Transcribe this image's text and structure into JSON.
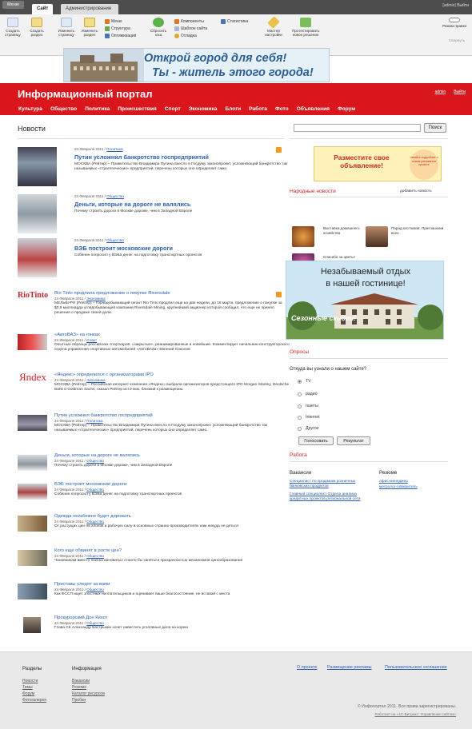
{
  "admin": {
    "tabs": {
      "menu": "Меню",
      "site": "Сайт",
      "admin": "Администрирование"
    },
    "right": "[admin]   Выйти",
    "buttons": [
      {
        "label": "Создать страницу",
        "icon": "create-page-icon"
      },
      {
        "label": "Создать раздел",
        "icon": "create-section-icon"
      },
      {
        "label": "Изменить страницу",
        "icon": "edit-page-icon"
      },
      {
        "label": "Изменить раздел",
        "icon": "edit-section-icon"
      }
    ],
    "menu_items": [
      "Меню",
      "Структура",
      "Оптимизация"
    ],
    "reset_cache": "Сбросить кэш",
    "components_items": [
      "Компоненты",
      "Шаблон сайта",
      "Отладка"
    ],
    "stats": "Статистика",
    "wizard": "Мастер настройки",
    "test": "Протестировать новое решение",
    "edit_mode": "Режим правки",
    "collapse": "Свернуть"
  },
  "banner": {
    "line1": "Открой город для себя!",
    "line2": "Ты - житель этого города!"
  },
  "header": {
    "title": "Информационный портал",
    "links": [
      "admin",
      "Выйти"
    ]
  },
  "nav": [
    "Культура",
    "Общество",
    "Политика",
    "Происшествия",
    "Спорт",
    "Экономика",
    "Блоги",
    "Работа",
    "Фото",
    "Объявления",
    "Форум"
  ],
  "news": {
    "heading": "Новости",
    "featured": [
      {
        "date": "24 Февраля 2011",
        "rubric": "Политика",
        "title": "Путин усложнил банкротство госпредприятий",
        "text": "МОСКВА (Рейтер) – Правительство Владимира Путина внесло в Госдуму законопроект, усложняющий банкротство так называемых «стратегических» предприятий, перечень которых оно определяет само."
      },
      {
        "date": "24 Февраля 2011",
        "rubric": "Общество",
        "title": "Деньги, которые на дороге не валялись",
        "text": "Почему строить дороги в Москве дороже, чем в Западной Европе"
      },
      {
        "date": "24 Февраля 2011",
        "rubric": "Общество",
        "title": "ВЭБ построит московские дороги",
        "text": "Собянин попросил у ВЭБа денег на подготовку транспортных проектов"
      }
    ],
    "list": [
      {
        "logo": "RioTinto",
        "title": "Rio Tinto продлила предложение о покупке Riversdale",
        "date": "24 Февраля 2011",
        "rubric": "Экономика",
        "text": "МЕЛЬБУРН (Рейтер) – Горнодобывающий гигант Rio Tinto продлил еще на две недели, до 18 марта, предложение о покупке за $3,9 миллиарда угледобывающей компании Riversdale Mining, крупнейший акционер которой сообщил, что еще не принял решения о продаже своей доли."
      },
      {
        "logo": "",
        "title": "«АвтоВАЗ» на гонках",
        "date": "24 Февраля 2011",
        "rubric": "Спорт",
        "text": "Опытные образцы российских спорткаров: «закрытые», реанимированные и новейшие. Комментирует начальник конструкторского отдела управления спортивных автомобилей «АвтоВАЗа» Евгений Соколов"
      },
      {
        "logo": "Яndex",
        "title": "«Яндекс» определился с организаторами IPO",
        "date": "24 Февраля 2011",
        "rubric": "Экономика",
        "text": "МОСКВА (Рейтер) – Российская интернет-компания «Яндекс» выбрала организаторов предстоящего IPO Morgan Stanley, Deutsche Bank и Goldman Sachs, сказал Рейтер источник, близкий к размещению."
      },
      {
        "logo": "",
        "title": "Путин усложнил банкротство госпредприятий",
        "date": "24 Февраля 2011",
        "rubric": "Политика",
        "text": "МОСКВА (Рейтер) – Правительство Владимира Путина внесло в Госдуму законопроект, усложняющий банкротство так называемых «стратегических» предприятий, перечень которых оно определяет само."
      },
      {
        "logo": "",
        "title": "Деньги, которые на дороге не валялись",
        "date": "24 Февраля 2011",
        "rubric": "Общество",
        "text": "Почему строить дороги в Москве дороже, чем в Западной Европе"
      },
      {
        "logo": "",
        "title": "ВЭБ построит московские дороги",
        "date": "24 Февраля 2011",
        "rubric": "Общество",
        "text": "Собянин попросил у ВЭБа денег на подготовку транспортных проектов"
      },
      {
        "logo": "",
        "title": "Одежда неизбежно будет дорожать",
        "date": "24 Февраля 2011",
        "rubric": "Общество",
        "text": "От растущих цен на хлопок и рабочую силу в основных странах-производителях нам никуда не деться"
      },
      {
        "logo": "",
        "title": "Кого еще обвинят в росте цен?",
        "date": "24 Февраля 2011",
        "rubric": "Общество",
        "text": "Чиновникам вместо поиска виноватых стоило бы заняться прозрачностью механизмов ценообразования"
      },
      {
        "logo": "",
        "title": "Приставы следят за вами",
        "date": "24 Февраля 2011",
        "rubric": "Общество",
        "text": "Как ФССП ищет злостных неплательщиков и оценивает ваше благосостояние, не вставая с места"
      },
      {
        "logo": "",
        "title": "Прокурорский Дон Кихот",
        "date": "24 Февраля 2011",
        "rubric": "Общество",
        "text": "Глава СК Александр Бастрыкин хочет навестить уголовные дела на корню"
      }
    ]
  },
  "search": {
    "placeholder": "",
    "button": "Поиск"
  },
  "ad_top": {
    "text": "Разместите свое объявление!",
    "badge": "Узнайте подробнее о новом рекламном проекте"
  },
  "people_news": {
    "heading": "Народные новости",
    "add": "добавить новость",
    "items": [
      "Выставка домашнего хозяйства",
      "Парад костюмов. Приглашаем всех.",
      "Спасибо за цветы!"
    ]
  },
  "ad_hotel": {
    "line1": "Незабываемый отдых",
    "line2": "в нашей гостинице!",
    "stamp": "Сезонные скидки!"
  },
  "poll": {
    "heading": "Опросы",
    "question": "Откуда вы узнали о нашем сайте?",
    "options": [
      "TV",
      "радио",
      "газеты",
      "Internet",
      "Другое"
    ],
    "selected": 0,
    "vote": "Голосовать",
    "result": "Результат"
  },
  "jobs": {
    "heading": "Работа",
    "vacancies_head": "Вакансии",
    "resume_head": "Резюме",
    "vacancies": [
      "Специалист по продажам розничных банковских продуктов",
      "Главный специалист Отдела анализа кредитных проектов региональной сети"
    ],
    "resumes": [
      "офис-менеджер",
      "метролог-поверитель"
    ]
  },
  "footer": {
    "col1_head": "Разделы",
    "col1": [
      "Новости",
      "Темы",
      "Форум",
      "Фотогалерея"
    ],
    "col2_head": "Информация",
    "col2": [
      "Вакансии",
      "Резюме",
      "Каталог ресурсов",
      "Пробки"
    ],
    "top_links": [
      "О проекте",
      "Размещение рекламы",
      "Пользовательское соглашение"
    ],
    "copyright": "© Инфопортал 2011. Все права зарегистрированы.",
    "made_by": "Работает на «1С-Битрикс: Управление сайтом»"
  },
  "colors": {
    "brand_red": "#d8161b",
    "link": "#2a60b4",
    "admin_bar": "#4d4d4d"
  }
}
